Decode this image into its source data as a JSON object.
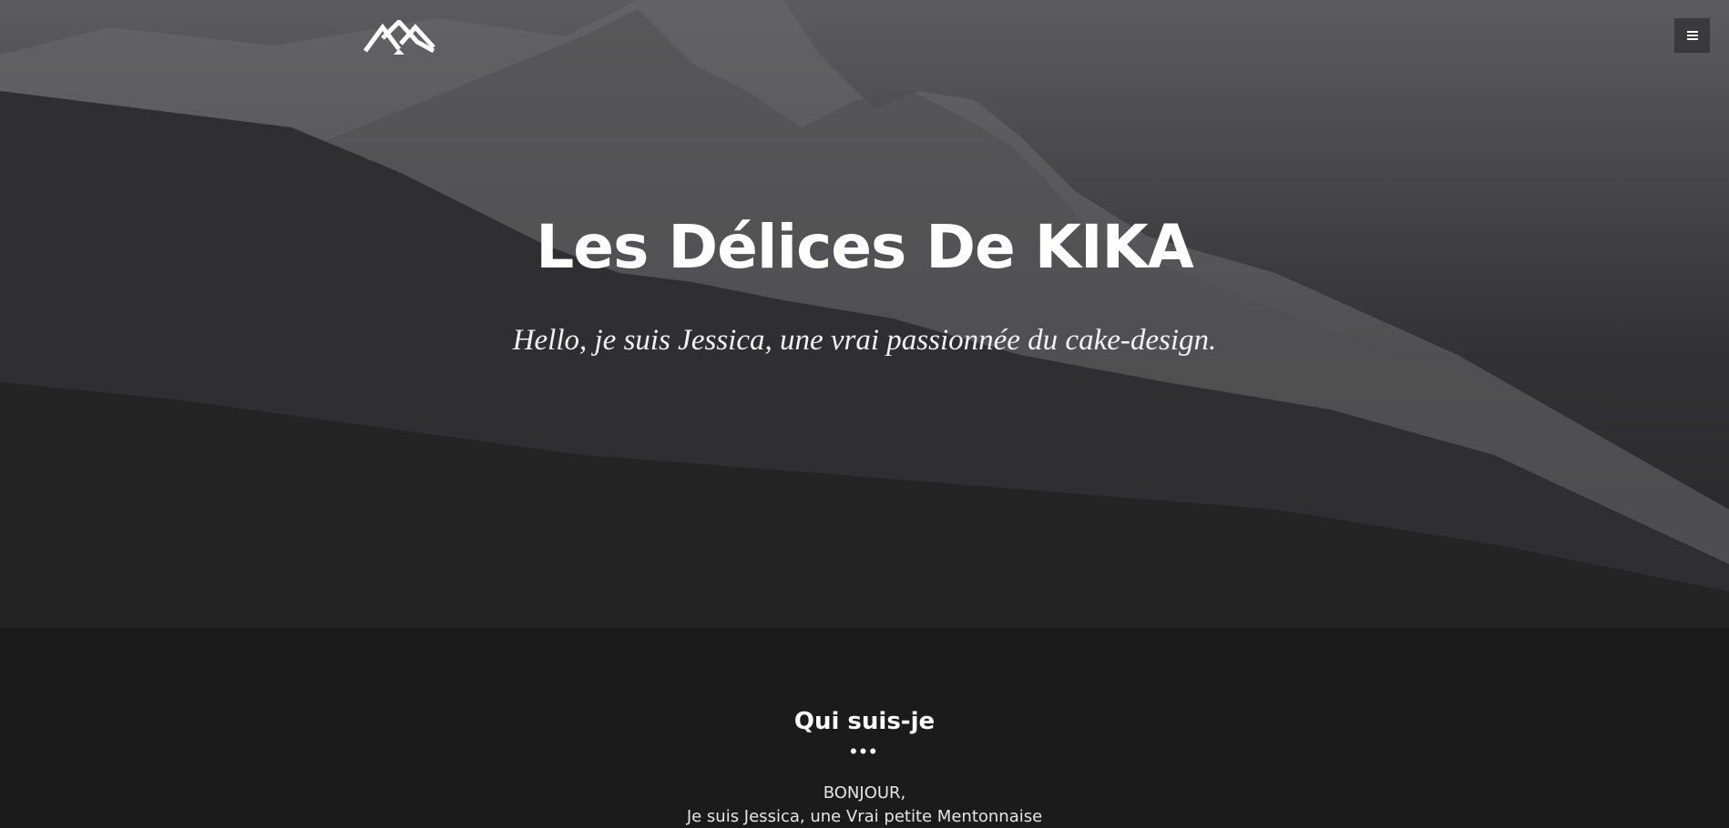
{
  "header": {
    "logo_icon": "mountain-logo-icon",
    "menu_icon": "hamburger-menu-icon"
  },
  "hero": {
    "title": "Les Délices De KIKA",
    "subtitle": "Hello, je suis Jessica, une vrai passionnée du cake-design."
  },
  "about": {
    "title": "Qui suis-je",
    "dots": "•••",
    "greeting": "BONJOUR,",
    "intro": "Je suis Jessica, une Vrai petite Mentonnaise"
  },
  "colors": {
    "hero_top": "#5c5c5e",
    "hero_bottom": "#262627",
    "section_bg": "#1b1b1c",
    "text": "#ffffff",
    "menu_button_bg": "#3a3a3c"
  }
}
